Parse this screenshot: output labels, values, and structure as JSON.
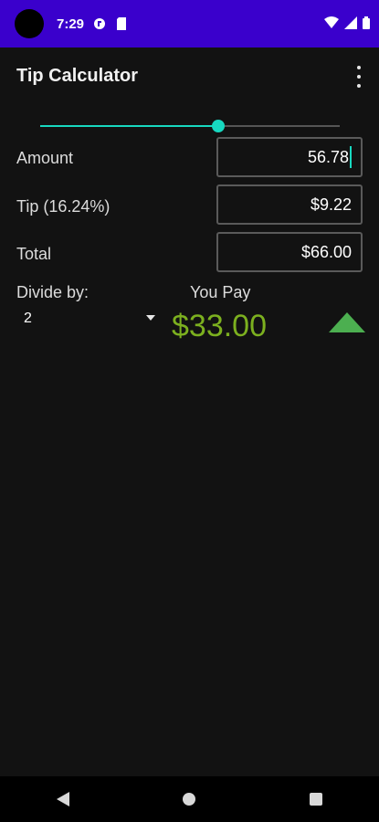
{
  "status_bar": {
    "time": "7:29",
    "icons": [
      "camera-cutout",
      "data-saver-icon",
      "sim-card-icon",
      "wifi-icon",
      "signal-icon",
      "battery-icon"
    ],
    "background": "#3a00cc"
  },
  "app_bar": {
    "title": "Tip Calculator",
    "menu_icon": "overflow-menu-icon"
  },
  "tip_slider": {
    "fraction": 0.5955,
    "accent": "#17d8c0"
  },
  "rows": {
    "amount": {
      "label": "Amount",
      "value": "56.78"
    },
    "tip": {
      "label": "Tip (16.24%)",
      "value": "$9.22"
    },
    "total": {
      "label": "Total",
      "value": "$66.00"
    }
  },
  "split": {
    "divide_label": "Divide by:",
    "divide_value": "2",
    "you_pay_label": "You Pay",
    "you_pay_value": "$33.00",
    "you_pay_color": "#7cb01f",
    "round_up_icon": "up-arrow-icon"
  },
  "nav_bar": {
    "buttons": [
      "back-icon",
      "home-icon",
      "recents-icon"
    ]
  }
}
